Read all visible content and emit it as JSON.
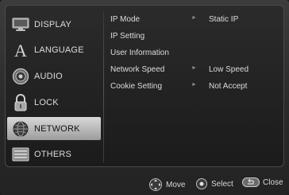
{
  "sidebar": {
    "items": [
      {
        "label": "DISPLAY",
        "icon": "display-icon",
        "active": false
      },
      {
        "label": "LANGUAGE",
        "icon": "language-icon",
        "active": false
      },
      {
        "label": "AUDIO",
        "icon": "audio-icon",
        "active": false
      },
      {
        "label": "LOCK",
        "icon": "lock-icon",
        "active": false
      },
      {
        "label": "NETWORK",
        "icon": "network-icon",
        "active": true
      },
      {
        "label": "OTHERS",
        "icon": "others-icon",
        "active": false
      }
    ]
  },
  "settings": {
    "rows": [
      {
        "label": "IP Mode",
        "value": "Static IP"
      },
      {
        "label": "IP Setting",
        "value": ""
      },
      {
        "label": "User Information",
        "value": ""
      },
      {
        "label": "Network Speed",
        "value": "Low Speed"
      },
      {
        "label": "Cookie Setting",
        "value": "Not Accept"
      }
    ]
  },
  "footer": {
    "move_label": "Move",
    "select_label": "Select",
    "close_label": "Close"
  },
  "colors": {
    "active_highlight": "#c8c8c8",
    "text": "#dcdcdc",
    "background": "#1c1c1c"
  }
}
